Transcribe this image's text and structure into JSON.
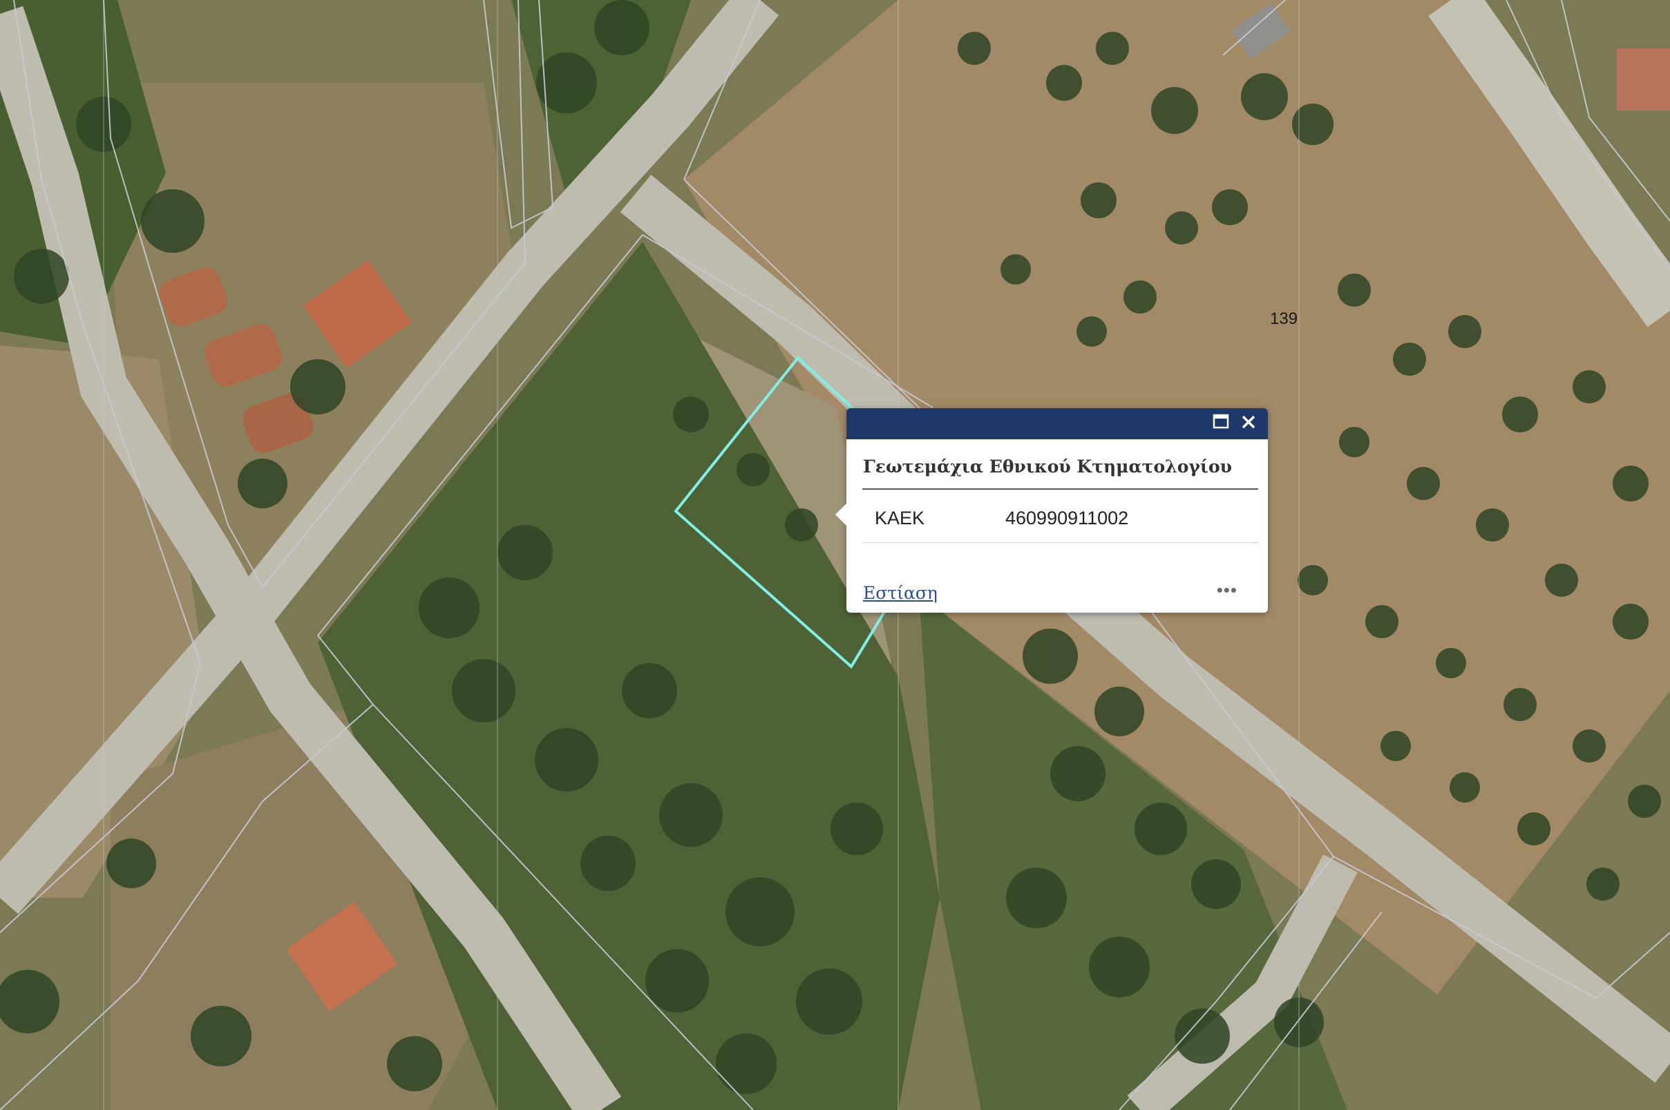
{
  "map": {
    "parcel_label": "139",
    "highlight_color": "#7ff0e8"
  },
  "popup": {
    "title": "Γεωτεμάχια Εθνικού Κτηματολογίου",
    "attribute_key": "ΚΑΕΚ",
    "attribute_value": "460990911002",
    "zoom_link": "Εστίαση",
    "more": "•••",
    "header_color": "#1d3869"
  }
}
